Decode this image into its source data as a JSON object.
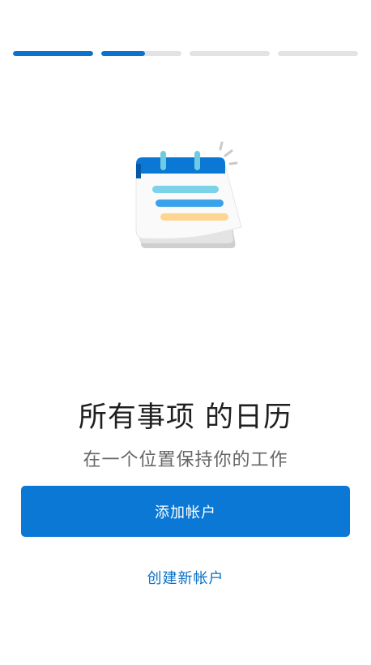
{
  "progress": {
    "steps": [
      {
        "fill_fraction": 1.0
      },
      {
        "fill_fraction": 0.55
      },
      {
        "fill_fraction": 0.0
      },
      {
        "fill_fraction": 0.0
      }
    ]
  },
  "illustration": {
    "icon": "calendar-notes-icon"
  },
  "content": {
    "title": "所有事项 的日历",
    "subtitle": "在一个位置保持你的工作"
  },
  "actions": {
    "add_account_label": "添加帐户",
    "create_account_label": "创建新帐户"
  },
  "colors": {
    "accent": "#0a78d4",
    "progress_track": "#e3e3e3",
    "link": "#0a6fc5"
  }
}
